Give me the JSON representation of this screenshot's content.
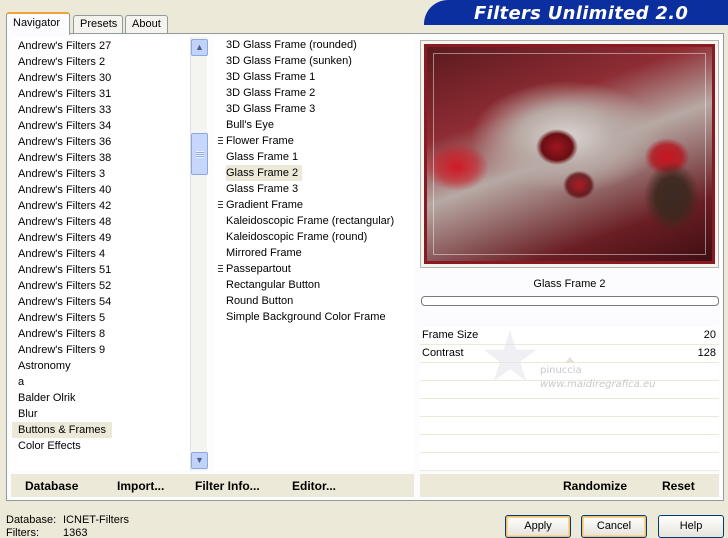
{
  "tabs": [
    {
      "label": "Navigator",
      "active": true
    },
    {
      "label": "Presets",
      "active": false
    },
    {
      "label": "About",
      "active": false
    }
  ],
  "banner_title": "Filters Unlimited 2.0",
  "categories": [
    "Andrew's Filters 27",
    "Andrew's Filters 2",
    "Andrew's Filters 30",
    "Andrew's Filters 31",
    "Andrew's Filters 33",
    "Andrew's Filters 34",
    "Andrew's Filters 36",
    "Andrew's Filters 38",
    "Andrew's Filters 3",
    "Andrew's Filters 40",
    "Andrew's Filters 42",
    "Andrew's Filters 48",
    "Andrew's Filters 49",
    "Andrew's Filters 4",
    "Andrew's Filters 51",
    "Andrew's Filters 52",
    "Andrew's Filters 54",
    "Andrew's Filters 5",
    "Andrew's Filters 8",
    "Andrew's Filters 9",
    "Astronomy",
    "a",
    "Balder Olrik",
    "Blur",
    "Buttons & Frames",
    "Color Effects"
  ],
  "selected_category": "Buttons & Frames",
  "filters": [
    {
      "label": "3D Glass Frame (rounded)",
      "marker": false
    },
    {
      "label": "3D Glass Frame (sunken)",
      "marker": false
    },
    {
      "label": "3D Glass Frame 1",
      "marker": false
    },
    {
      "label": "3D Glass Frame 2",
      "marker": false
    },
    {
      "label": "3D Glass Frame 3",
      "marker": false
    },
    {
      "label": "Bull's Eye",
      "marker": false
    },
    {
      "label": "Flower Frame",
      "marker": true
    },
    {
      "label": "Glass Frame 1",
      "marker": false
    },
    {
      "label": "Glass Frame 2",
      "marker": false
    },
    {
      "label": "Glass Frame 3",
      "marker": false
    },
    {
      "label": "Gradient Frame",
      "marker": true
    },
    {
      "label": "Kaleidoscopic Frame (rectangular)",
      "marker": false
    },
    {
      "label": "Kaleidoscopic Frame (round)",
      "marker": false
    },
    {
      "label": "Mirrored Frame",
      "marker": false
    },
    {
      "label": "Passepartout",
      "marker": true
    },
    {
      "label": "Rectangular Button",
      "marker": false
    },
    {
      "label": "Round Button",
      "marker": false
    },
    {
      "label": "Simple Background Color Frame",
      "marker": false
    }
  ],
  "selected_filter": "Glass Frame 2",
  "preview": {
    "label": "Glass Frame 2",
    "progress": 0
  },
  "params": [
    {
      "label": "Frame Size",
      "value": "20"
    },
    {
      "label": "Contrast",
      "value": "128"
    }
  ],
  "watermark": {
    "line1": "pinuccia",
    "line2": "www.maidiregrafica.eu"
  },
  "toolbar": {
    "database": "Database",
    "import": "Import...",
    "filter_info": "Filter Info...",
    "editor": "Editor...",
    "randomize": "Randomize",
    "reset": "Reset"
  },
  "status": {
    "database_key": "Database:",
    "database_value": "ICNET-Filters",
    "filters_key": "Filters:",
    "filters_value": "1363"
  },
  "buttons": {
    "apply": "Apply",
    "cancel": "Cancel",
    "help": "Help"
  },
  "colors": {
    "banner": "#0b2f9e",
    "window_bg": "#ece9d8",
    "tab_highlight": "#f1a23b"
  }
}
